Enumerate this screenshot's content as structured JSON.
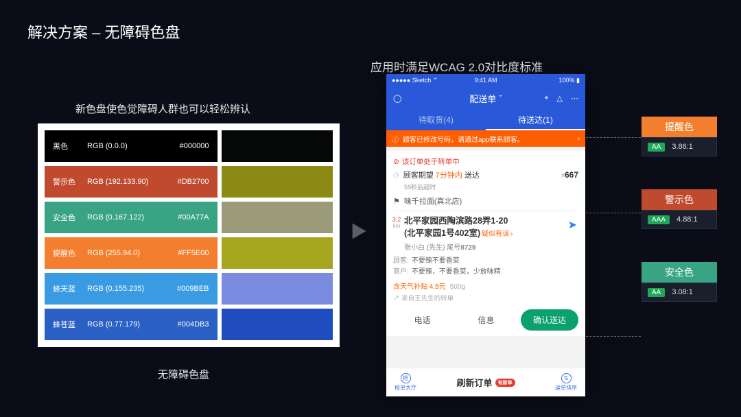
{
  "title": "解决方案 – 无障碍色盘",
  "palette": {
    "subtitle": "新色盘使色觉障碍人群也可以轻松辨认",
    "caption": "无障碍色盘",
    "rows": [
      {
        "name": "黑色",
        "rgb": "RGB (0.0.0)",
        "hex": "#000000",
        "sim": "#050806"
      },
      {
        "name": "警示色",
        "rgb": "RGB (192.133.90)",
        "hex": "#DB2700",
        "main": "#c04a2e",
        "sim": "#8a8a14"
      },
      {
        "name": "安全色",
        "rgb": "RGB (0.167.122)",
        "hex": "#00A77A",
        "main": "#39a483",
        "sim": "#9b9b7a"
      },
      {
        "name": "提醒色",
        "rgb": "RGB (255.94.0)",
        "hex": "#FF5E00",
        "main": "#f37f2e",
        "sim": "#a6a61e"
      },
      {
        "name": "蜂天蓝",
        "rgb": "RGB (0.155.235)",
        "hex": "#009BEB",
        "main": "#3a9be3",
        "sim": "#7a8be0"
      },
      {
        "name": "蜂苍蓝",
        "rgb": "RGB (0.77.179)",
        "hex": "#004DB3",
        "main": "#2a5fc4",
        "sim": "#1f4dc0"
      }
    ]
  },
  "phone": {
    "subtitle": "应用时满足WCAG 2.0对比度标准",
    "status": {
      "carrier": "Sketch",
      "time": "9:41 AM",
      "battery": "100%"
    },
    "appbar": {
      "title": "配送单"
    },
    "tabs": [
      "待取货(4)",
      "待送达(1)"
    ],
    "alert": "顾客已修改号码，请通过app联系顾客。",
    "card": {
      "transfer": "该订单处于转单中",
      "expect_prefix": "顾客期望",
      "expect_time": "7分钟内",
      "expect_suffix": "送达",
      "order_no": "667",
      "overdue": "59秒后超时",
      "shop": "味千拉面(真北店)",
      "distance": "3.2",
      "distance_unit": "km",
      "addr1": "北平家园西陶滨路28弄1-20",
      "addr2": "北平家园1号402室",
      "suspect": "疑似有误",
      "person": "张小白 (先生)",
      "tail_lbl": "尾号",
      "tail": "8729",
      "note1_lbl": "顾客:",
      "note1": "不要辣不要香菜",
      "note2_lbl": "商户:",
      "note2": "不要辣，不要香菜，少放味精",
      "supplement": "含天气补贴 4.5元",
      "weight": "500g",
      "forward": "来自王先生的转单"
    },
    "actions": {
      "call": "电话",
      "msg": "信息",
      "confirm": "确认送达"
    },
    "bottom": {
      "left": "抢单大厅",
      "center": "刷新订单",
      "badge": "有新单",
      "right": "运单排序"
    }
  },
  "tags": [
    {
      "label": "提醒色",
      "color": "#f37f2e",
      "level": "AA",
      "ratio": "3.86:1"
    },
    {
      "label": "警示色",
      "color": "#c04a2e",
      "level": "AAA",
      "ratio": "4.88:1"
    },
    {
      "label": "安全色",
      "color": "#39a483",
      "level": "AA",
      "ratio": "3.08:1"
    }
  ]
}
